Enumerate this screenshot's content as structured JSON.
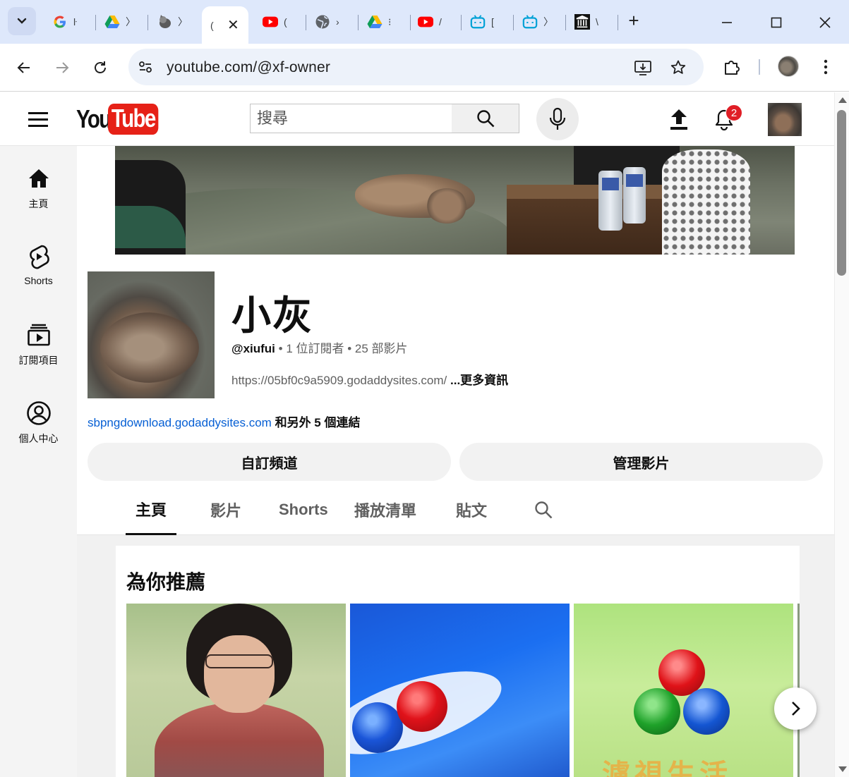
{
  "browser": {
    "tabs": [
      {
        "icon": "google-g-icon",
        "title": "ŀ"
      },
      {
        "icon": "google-drive-icon",
        "title": "〉"
      },
      {
        "icon": "cat-avatar-icon",
        "title": "〉"
      },
      {
        "icon": "tab-active",
        "title": "(",
        "active": true,
        "close": "✕"
      },
      {
        "icon": "youtube-icon",
        "title": "("
      },
      {
        "icon": "globe-icon",
        "title": "›"
      },
      {
        "icon": "google-drive-icon",
        "title": "⁝"
      },
      {
        "icon": "youtube-icon",
        "title": "/"
      },
      {
        "icon": "bilibili-icon",
        "title": "["
      },
      {
        "icon": "bilibili-icon",
        "title": "〉"
      },
      {
        "icon": "museum-icon",
        "title": "\\"
      }
    ],
    "new_tab": "+",
    "url": "youtube.com/@xf-owner"
  },
  "youtube": {
    "logo_you": "You",
    "logo_tube": "Tube",
    "search_placeholder": "搜尋",
    "notification_count": "2",
    "sidebar": [
      {
        "label": "主頁",
        "icon": "home-icon"
      },
      {
        "label": "Shorts",
        "icon": "shorts-icon"
      },
      {
        "label": "訂閱項目",
        "icon": "subscriptions-icon"
      },
      {
        "label": "個人中心",
        "icon": "account-icon"
      }
    ],
    "channel": {
      "name": "小灰",
      "handle": "@xiufui",
      "subscribers": "1 位訂閱者",
      "videos": "25 部影片",
      "sep": " • ",
      "description": "https://05bf0c9a5909.godaddysites.com/",
      "more": "...更多資訊",
      "link": "sbpngdownload.godaddysites.com",
      "more_links": "和另外 5 個連結",
      "customize_button": "自訂頻道",
      "manage_button": "管理影片"
    },
    "tabs": [
      {
        "label": "主頁",
        "active": true
      },
      {
        "label": "影片"
      },
      {
        "label": "Shorts"
      },
      {
        "label": "播放清單"
      },
      {
        "label": "貼文"
      }
    ],
    "shelf_title": "為你推薦",
    "thumb3_text": "濾視生活"
  }
}
